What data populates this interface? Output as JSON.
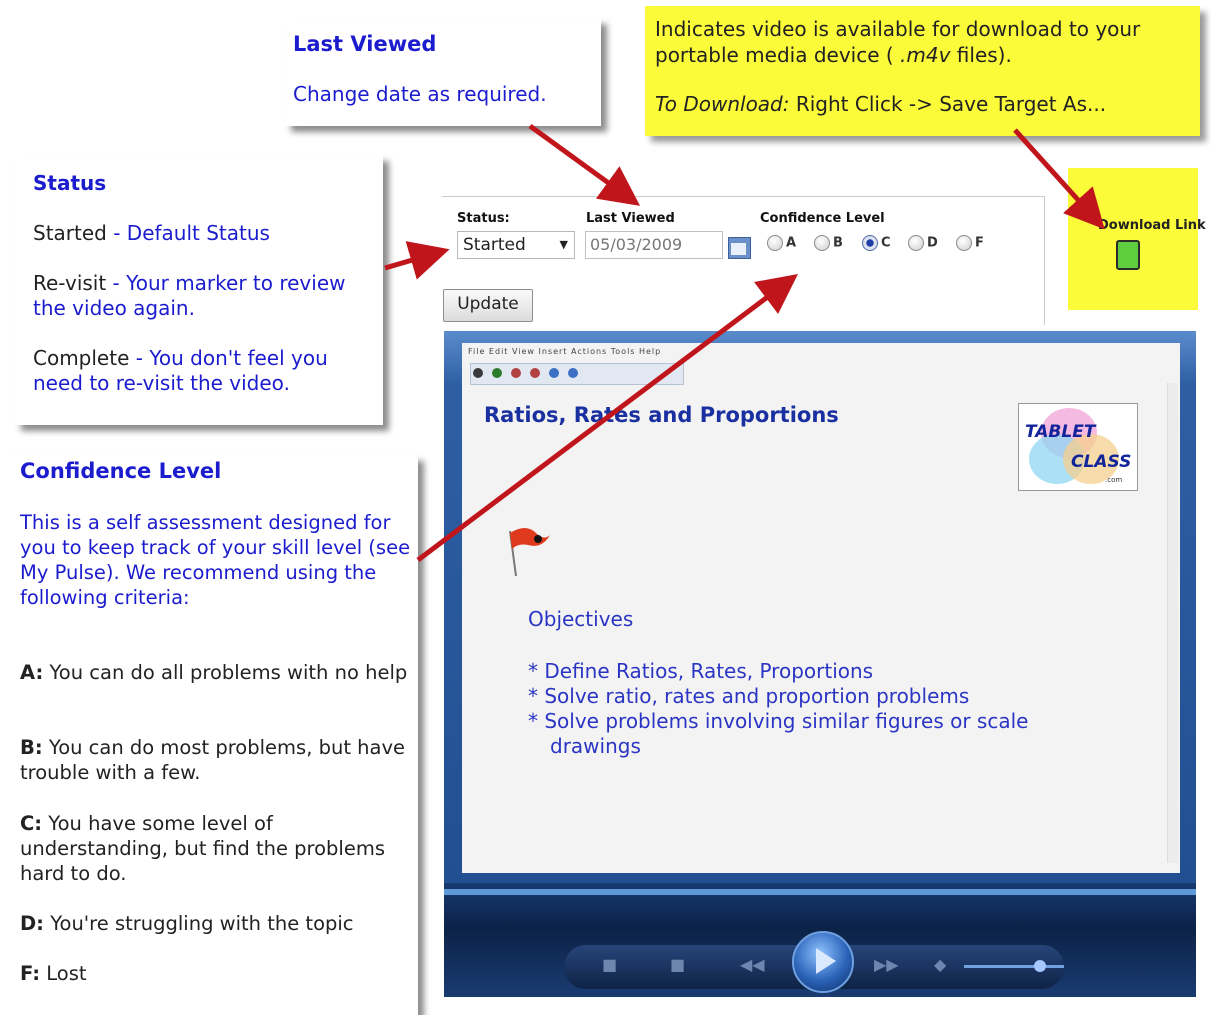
{
  "callouts": {
    "last_viewed": {
      "title": "Last Viewed",
      "text": "Change date as required."
    },
    "download_note": {
      "line1": "Indicates video is available for download to your portable media device ( ",
      "ext": ".m4v",
      "line1_end": " files).",
      "line2_prefix": "To Download:",
      "line2_text": " Right Click -> Save Target As..."
    },
    "status": {
      "title": "Status",
      "items": [
        {
          "term": "Started",
          "sep": " - ",
          "desc": "Default Status"
        },
        {
          "term": "Re-visit",
          "sep": " - ",
          "desc": "Your marker to review the video again."
        },
        {
          "term": "Complete",
          "sep": " - ",
          "desc": "You don't feel you need to re-visit the video."
        }
      ]
    },
    "confidence": {
      "title": "Confidence Level",
      "intro": "This is a self assessment designed for you to keep track of your skill level (see My Pulse). We recommend using the following criteria:",
      "criteria": [
        {
          "key": "A:",
          "text": " You can do all problems with no help"
        },
        {
          "key": "B:",
          "text": " You can do most problems, but have trouble with a few."
        },
        {
          "key": "C:",
          "text": " You have some level of understanding, but find the problems hard to do."
        },
        {
          "key": "D:",
          "text": " You're struggling with the topic"
        },
        {
          "key": "F:",
          "text": " Lost"
        }
      ]
    }
  },
  "panel": {
    "status_label": "Status:",
    "status_value": "Started",
    "last_viewed_label": "Last Viewed",
    "last_viewed_value": "05/03/2009",
    "confidence_label": "Confidence Level",
    "confidence_options": [
      "A",
      "B",
      "C",
      "D",
      "F"
    ],
    "confidence_selected": "C",
    "update_button": "Update"
  },
  "download": {
    "label": "Download Link"
  },
  "player": {
    "menu": "File  Edit  View  Insert  Actions  Tools  Help",
    "slide_title": "Ratios, Rates and Proportions",
    "logo_line1": "TABLET",
    "logo_line2": "CLASS",
    "logo_line3": ".com",
    "objectives_heading": "Objectives",
    "bullets": [
      "* Define Ratios, Rates, Proportions",
      "* Solve ratio, rates and proportion problems",
      "* Solve problems involving similar figures or scale drawings"
    ]
  },
  "colors": {
    "accent_blue": "#1c1ccf",
    "note_yellow": "#fbfb3a",
    "arrow_red": "#c0161b"
  }
}
